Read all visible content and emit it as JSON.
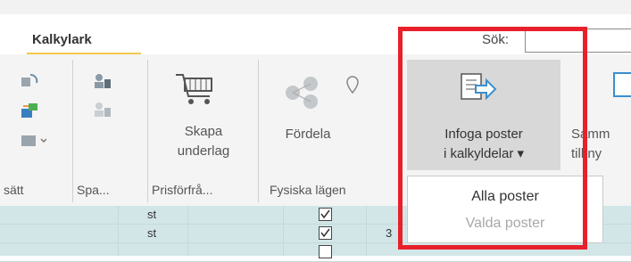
{
  "tabs": {
    "active": "Kalkylark"
  },
  "search": {
    "label": "Sök:",
    "value": "",
    "placeholder": ""
  },
  "ribbon": {
    "buttons": {
      "skapa_underlag": "Skapa\nunderlag",
      "fordela": "Fördela",
      "infoga_poster": "Infoga poster\ni kalkyldelar ▾",
      "samm_partial": "Samm\ntill ny"
    },
    "groups": [
      "sätt",
      "Spa...",
      "Prisförfrå...",
      "Fysiska lägen"
    ],
    "dropdown_items": [
      "Alla poster",
      "Valda poster"
    ]
  },
  "table": {
    "rows": [
      {
        "unit": "st",
        "checked": true,
        "value": ""
      },
      {
        "unit": "st",
        "checked": true,
        "value": "3"
      },
      {
        "unit": "",
        "checked": true,
        "value": ""
      }
    ]
  },
  "colors": {
    "highlight_border": "#e8202a",
    "tab_underline": "#f2c94c",
    "table_bg": "#d2e6e8"
  }
}
